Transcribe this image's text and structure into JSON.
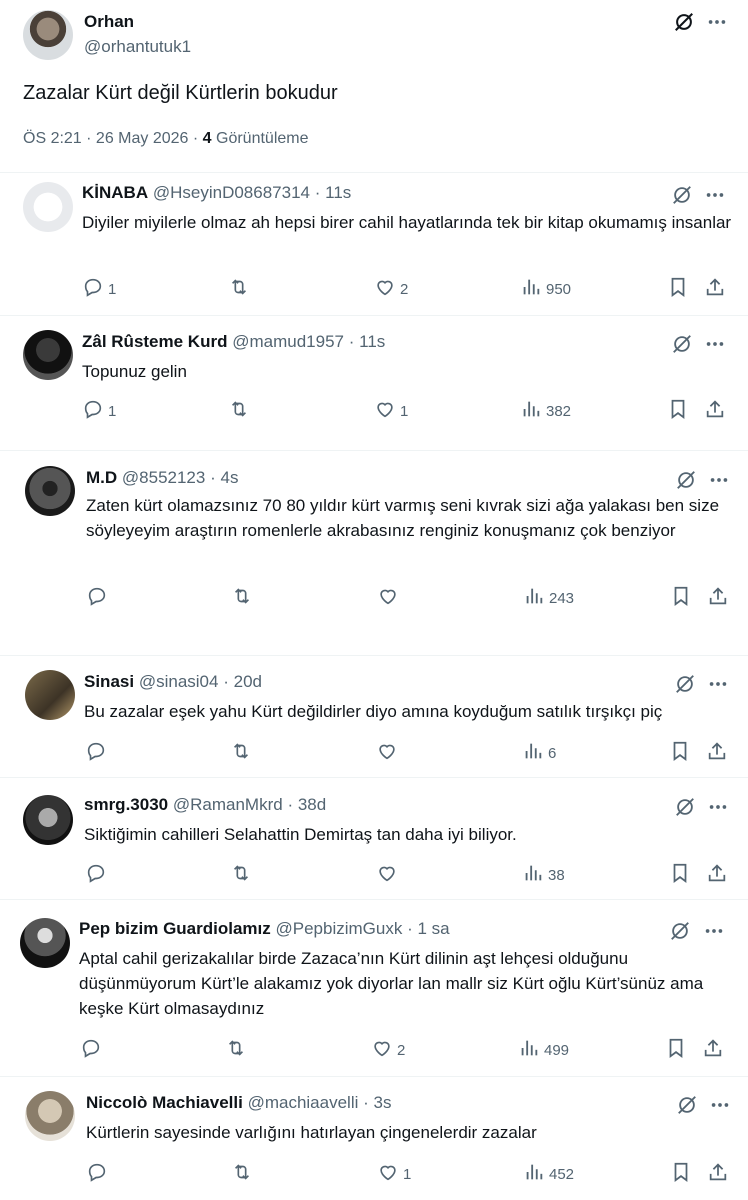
{
  "main_post": {
    "name": "Orhan",
    "handle": "@orhantutuk1",
    "text": "Zazalar Kürt değil Kürtlerin bokudur",
    "time": "ÖS 2:21 · 26 May 2026 · ",
    "views_count": "4",
    "views_label": " Görüntüleme"
  },
  "replies": [
    {
      "name": "KİNABA",
      "handle": "@HseyinD08687314",
      "time": "11s",
      "text": "Diyiler miyilerle olmaz ah hepsi birer cahil hayatlarında tek bir kitap okumamış insanlar",
      "replies": "1",
      "retweets": "",
      "likes": "2",
      "views": "950"
    },
    {
      "name": "Zâl Rûsteme Kurd",
      "handle": "@mamud1957",
      "time": "11s",
      "text": "Topunuz gelin",
      "replies": "1",
      "retweets": "",
      "likes": "1",
      "views": "382"
    },
    {
      "name": "M.D",
      "handle": "@8552123",
      "time": "4s",
      "text": "Zaten kürt olamazsınız 70 80 yıldır kürt varmış seni kıvrak sizi ağa yalakası ben size söyleyeyim  araştırın romenlerle akrabasınız renginiz konuşmanız çok benziyor",
      "replies": "",
      "retweets": "",
      "likes": "",
      "views": "243"
    },
    {
      "name": "Sinasi",
      "handle": "@sinasi04",
      "time": "20d",
      "text": "Bu zazalar eşek yahu Kürt değildirler diyo amına koyduğum satılık tırşıkçı piç",
      "replies": "",
      "retweets": "",
      "likes": "",
      "views": "6"
    },
    {
      "name": "smrg.3030",
      "handle": "@RamanMkrd",
      "time": "38d",
      "text": "Siktiğimin cahilleri Selahattin Demirtaş tan daha iyi biliyor.",
      "replies": "",
      "retweets": "",
      "likes": "",
      "views": "38"
    },
    {
      "name": "Pep bizim Guardiolamız",
      "handle": "@PepbizimGuxk",
      "time": "1 sa",
      "text": "Aptal cahil gerizakalılar birde Zazaca’nın Kürt dilinin aşt lehçesi olduğunu düşünmüyorum Kürt’le alakamız yok diyorlar lan mallr siz Kürt oğlu Kürt’sünüz ama keşke Kürt olmasaydınız",
      "replies": "",
      "retweets": "",
      "likes": "2",
      "views": "499"
    },
    {
      "name": "Niccolò Machiavelli",
      "handle": "@machiaavelli",
      "time": "3s",
      "text": "Kürtlerin sayesinde varlığını hatırlayan çingenelerdir zazalar",
      "replies": "",
      "retweets": "",
      "likes": "1",
      "views": "452"
    }
  ],
  "separator": "·"
}
